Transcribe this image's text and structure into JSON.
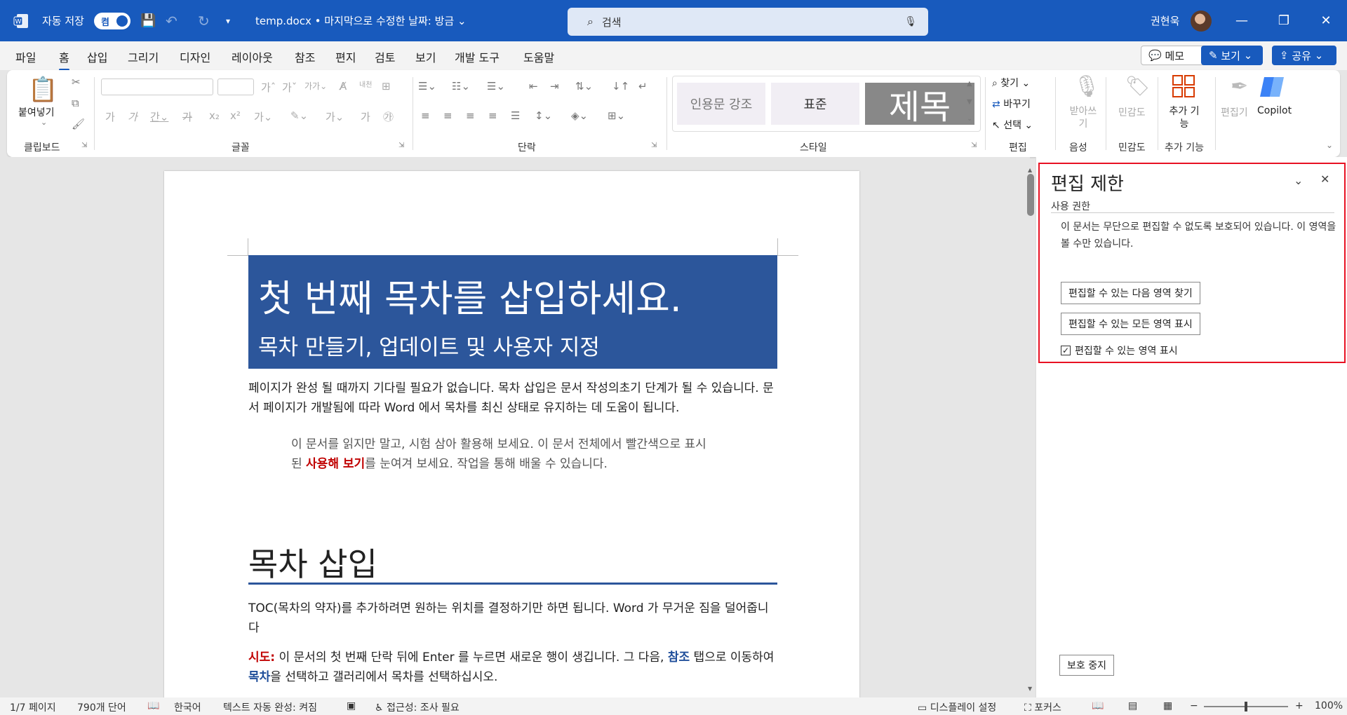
{
  "titlebar": {
    "autosave_label": "자동 저장",
    "autosave_state": "켬",
    "doc_title": "temp.docx • 마지막으로 수정한 날짜: 방금",
    "search_placeholder": "검색",
    "user_name": "권현욱"
  },
  "menu": {
    "tabs": [
      "파일",
      "홈",
      "삽입",
      "그리기",
      "디자인",
      "레이아웃",
      "참조",
      "편지",
      "검토",
      "보기",
      "개발 도구",
      "도움말"
    ],
    "active_tab": "홈",
    "memo": "메모",
    "view": "보기",
    "share": "공유"
  },
  "ribbon": {
    "groups": [
      "클립보드",
      "글꼴",
      "단락",
      "스타일",
      "편집",
      "음성",
      "민감도",
      "추가 기능"
    ],
    "paste": "붙여넣기",
    "styles": [
      "인용문 강조",
      "표준",
      "제목"
    ],
    "find": "찾기",
    "replace": "바꾸기",
    "select": "선택",
    "dictate": "받아쓰기",
    "sensitivity": "민감도",
    "addins": "추가 기능",
    "editor": "편집기",
    "copilot": "Copilot"
  },
  "document": {
    "title": "첫 번째 목차를 삽입하세요.",
    "subtitle": "목차 만들기, 업데이트 및 사용자 지정",
    "p1": "페이지가 완성 될 때까지 기다릴 필요가 없습니다. 목차 삽입은 문서 작성의초기 단계가 될 수 있습니다. 문서 페이지가 개발됨에 따라 Word 에서 목차를 최신 상태로 유지하는 데 도움이 됩니다.",
    "tip_a": "이 문서를 읽지만 말고, 시험 삼아 활용해 보세요. 이 문서 전체에서 빨간색으로 표시된 ",
    "tip_red": "사용해 보기",
    "tip_b": "를 눈여겨 보세요. 작업을 통해 배울 수 있습니다.",
    "section_heading": "목차 삽입",
    "p2": "TOC(목차의 약자)를 추가하려면 원하는 위치를 결정하기만 하면 됩니다. Word 가 무거운 짐을 덜어줍니다",
    "p3_label": "시도:",
    "p3_a": " 이 문서의 첫 번째 단락 뒤에 Enter 를 누르면 새로운 행이 생깁니다. 그 다음, ",
    "p3_ref": "참조",
    "p3_b": " 탭으로 이동하여 ",
    "p3_toc": "목차",
    "p3_c": "을 선택하고 갤러리에서 목차를 선택하십시오."
  },
  "pane": {
    "title": "편집 제한",
    "section": "사용 권한",
    "desc": "이 문서는 무단으로 편집할 수 없도록 보호되어 있습니다. 이 영역을 볼 수만 있습니다.",
    "btn_next": "편집할 수 있는 다음 영역 찾기",
    "btn_all": "편집할 수 있는 모든 영역 표시",
    "chk_label": "편집할 수 있는 영역 표시",
    "stop": "보호 중지"
  },
  "status": {
    "page": "1/7 페이지",
    "words": "790개 단어",
    "lang": "한국어",
    "autocomplete": "텍스트 자동 완성: 켜짐",
    "accessibility": "접근성: 조사 필요",
    "display": "디스플레이 설정",
    "focus": "포커스",
    "zoom": "100%"
  }
}
